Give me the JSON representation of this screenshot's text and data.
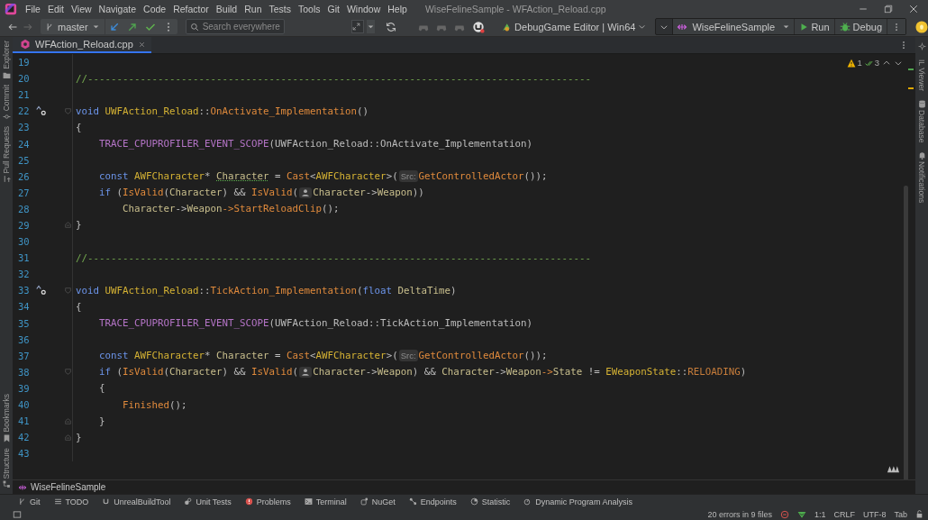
{
  "window": {
    "title": "WiseFelineSample - WFAction_Reload.cpp"
  },
  "menu": [
    "File",
    "Edit",
    "View",
    "Navigate",
    "Code",
    "Refactor",
    "Build",
    "Run",
    "Tests",
    "Tools",
    "Git",
    "Window",
    "Help"
  ],
  "toolbar": {
    "branch": "master",
    "search": {
      "placeholder": "Search everywhere"
    },
    "configuration": "DebugGame Editor | Win64",
    "run_target": "WiseFelineSample",
    "run_button": "Run",
    "debug_button": "Debug"
  },
  "left_strip_top": [
    {
      "label": "Explorer",
      "kind": "folder"
    },
    {
      "label": "Commit",
      "kind": "commit"
    },
    {
      "label": "Pull Requests",
      "kind": "pull"
    }
  ],
  "left_strip_bottom": [
    {
      "label": "Bookmarks",
      "kind": "bookmark"
    },
    {
      "label": "Structure",
      "kind": "structure"
    }
  ],
  "right_strip": [
    {
      "label": "IL Viewer",
      "kind": "plain"
    },
    {
      "label": "Database",
      "kind": "database"
    },
    {
      "label": "Notifications",
      "kind": "bell"
    }
  ],
  "tabs": [
    {
      "label": "WFAction_Reload.cpp",
      "selected": true
    }
  ],
  "inspections": {
    "warnings": "1",
    "weak_warnings": "3"
  },
  "code_lines": [
    {
      "number": "19"
    },
    {
      "number": "20",
      "tokens": [
        {
          "kind": "comment",
          "text": "//--------------------------------------------------------------------------------------"
        }
      ]
    },
    {
      "number": "21"
    },
    {
      "number": "22",
      "override_marker": true,
      "fold_start": true,
      "tokens": [
        {
          "kind": "kw",
          "text": "void"
        },
        {
          "kind": "type",
          "text": " UWFAction_Reload"
        },
        {
          "kind": "plain",
          "text": "::"
        },
        {
          "kind": "fn",
          "text": "OnActivate_Implementation"
        },
        {
          "kind": "plain",
          "text": "()"
        }
      ]
    },
    {
      "number": "23",
      "tokens": [
        {
          "kind": "plain",
          "text": "{"
        }
      ]
    },
    {
      "number": "24",
      "tokens": [
        {
          "kind": "macro",
          "text": "    TRACE_CPUPROFILER_EVENT_SCOPE"
        },
        {
          "kind": "plain",
          "text": "(UWFAction_Reload::OnActivate_Implementation)"
        }
      ]
    },
    {
      "number": "25"
    },
    {
      "number": "26",
      "tokens": [
        {
          "kind": "kw",
          "text": "    const"
        },
        {
          "kind": "type",
          "text": " AWFCharacter"
        },
        {
          "kind": "plain",
          "text": "* "
        },
        {
          "kind": "var",
          "text": "Character",
          "underlined": true
        },
        {
          "kind": "plain",
          "text": " = "
        },
        {
          "kind": "fn",
          "text": "Cast"
        },
        {
          "kind": "plain",
          "text": "<"
        },
        {
          "kind": "type",
          "text": "AWFCharacter"
        },
        {
          "kind": "plain",
          "text": ">("
        },
        {
          "kind": "hint",
          "text": "Src:"
        },
        {
          "kind": "fn",
          "text": "GetControlledActor"
        },
        {
          "kind": "plain",
          "text": "());"
        }
      ]
    },
    {
      "number": "27",
      "tokens": [
        {
          "kind": "kw",
          "text": "    if"
        },
        {
          "kind": "plain",
          "text": " ("
        },
        {
          "kind": "fn",
          "text": "IsValid"
        },
        {
          "kind": "plain",
          "text": "("
        },
        {
          "kind": "var",
          "text": "Character"
        },
        {
          "kind": "plain",
          "text": ") && "
        },
        {
          "kind": "fn",
          "text": "IsValid"
        },
        {
          "kind": "plain",
          "text": "("
        },
        {
          "kind": "hint-icon"
        },
        {
          "kind": "var",
          "text": "Character"
        },
        {
          "kind": "plain",
          "text": "->"
        },
        {
          "kind": "var",
          "text": "Weapon"
        },
        {
          "kind": "plain",
          "text": "))"
        }
      ]
    },
    {
      "number": "28",
      "tokens": [
        {
          "kind": "var",
          "text": "        Character"
        },
        {
          "kind": "plain",
          "text": "->"
        },
        {
          "kind": "var",
          "text": "Weapon"
        },
        {
          "kind": "op",
          "text": "->"
        },
        {
          "kind": "fn",
          "text": "StartReloadClip"
        },
        {
          "kind": "plain",
          "text": "();"
        }
      ]
    },
    {
      "number": "29",
      "fold_end": true,
      "tokens": [
        {
          "kind": "plain",
          "text": "}"
        }
      ]
    },
    {
      "number": "30"
    },
    {
      "number": "31",
      "tokens": [
        {
          "kind": "comment",
          "text": "//--------------------------------------------------------------------------------------"
        }
      ]
    },
    {
      "number": "32"
    },
    {
      "number": "33",
      "override_marker": true,
      "fold_start": true,
      "tokens": [
        {
          "kind": "kw",
          "text": "void"
        },
        {
          "kind": "type",
          "text": " UWFAction_Reload"
        },
        {
          "kind": "plain",
          "text": "::"
        },
        {
          "kind": "fn",
          "text": "TickAction_Implementation"
        },
        {
          "kind": "plain",
          "text": "("
        },
        {
          "kind": "kw",
          "text": "float"
        },
        {
          "kind": "var",
          "text": " DeltaTime"
        },
        {
          "kind": "plain",
          "text": ")"
        }
      ]
    },
    {
      "number": "34",
      "tokens": [
        {
          "kind": "plain",
          "text": "{"
        }
      ]
    },
    {
      "number": "35",
      "tokens": [
        {
          "kind": "macro",
          "text": "    TRACE_CPUPROFILER_EVENT_SCOPE"
        },
        {
          "kind": "plain",
          "text": "(UWFAction_Reload::TickAction_Implementation)"
        }
      ]
    },
    {
      "number": "36"
    },
    {
      "number": "37",
      "tokens": [
        {
          "kind": "kw",
          "text": "    const"
        },
        {
          "kind": "type",
          "text": " AWFCharacter"
        },
        {
          "kind": "plain",
          "text": "* "
        },
        {
          "kind": "var",
          "text": "Character"
        },
        {
          "kind": "plain",
          "text": " = "
        },
        {
          "kind": "fn",
          "text": "Cast"
        },
        {
          "kind": "plain",
          "text": "<"
        },
        {
          "kind": "type",
          "text": "AWFCharacter"
        },
        {
          "kind": "plain",
          "text": ">("
        },
        {
          "kind": "hint",
          "text": "Src:"
        },
        {
          "kind": "fn",
          "text": "GetControlledActor"
        },
        {
          "kind": "plain",
          "text": "());"
        }
      ]
    },
    {
      "number": "38",
      "fold_start": true,
      "tokens": [
        {
          "kind": "kw",
          "text": "    if"
        },
        {
          "kind": "plain",
          "text": " ("
        },
        {
          "kind": "fn",
          "text": "IsValid"
        },
        {
          "kind": "plain",
          "text": "("
        },
        {
          "kind": "var",
          "text": "Character"
        },
        {
          "kind": "plain",
          "text": ") && "
        },
        {
          "kind": "fn",
          "text": "IsValid"
        },
        {
          "kind": "plain",
          "text": "("
        },
        {
          "kind": "hint-icon"
        },
        {
          "kind": "var",
          "text": "Character"
        },
        {
          "kind": "plain",
          "text": "->"
        },
        {
          "kind": "var",
          "text": "Weapon"
        },
        {
          "kind": "plain",
          "text": ") && "
        },
        {
          "kind": "var",
          "text": "Character"
        },
        {
          "kind": "plain",
          "text": "->"
        },
        {
          "kind": "var",
          "text": "Weapon"
        },
        {
          "kind": "op",
          "text": "->"
        },
        {
          "kind": "var",
          "text": "State"
        },
        {
          "kind": "plain",
          "text": " != "
        },
        {
          "kind": "type",
          "text": "EWeaponState"
        },
        {
          "kind": "plain",
          "text": "::"
        },
        {
          "kind": "enum",
          "text": "RELOADING"
        },
        {
          "kind": "plain",
          "text": ")"
        }
      ]
    },
    {
      "number": "39",
      "tokens": [
        {
          "kind": "plain",
          "text": "    {"
        }
      ]
    },
    {
      "number": "40",
      "tokens": [
        {
          "kind": "fn",
          "text": "        Finished"
        },
        {
          "kind": "plain",
          "text": "();"
        }
      ]
    },
    {
      "number": "41",
      "fold_end": true,
      "tokens": [
        {
          "kind": "plain",
          "text": "    }"
        }
      ]
    },
    {
      "number": "42",
      "fold_end": true,
      "tokens": [
        {
          "kind": "plain",
          "text": "}"
        }
      ]
    },
    {
      "number": "43"
    }
  ],
  "breadcrumb": "WiseFelineSample",
  "tool_windows": [
    {
      "label": "Git",
      "kind": "git"
    },
    {
      "label": "TODO",
      "kind": "todo"
    },
    {
      "label": "UnrealBuildTool",
      "kind": "ubt"
    },
    {
      "label": "Unit Tests",
      "kind": "tests"
    },
    {
      "label": "Problems",
      "kind": "problems"
    },
    {
      "label": "Terminal",
      "kind": "terminal"
    },
    {
      "label": "NuGet",
      "kind": "nuget"
    },
    {
      "label": "Endpoints",
      "kind": "endpoints"
    },
    {
      "label": "Statistic",
      "kind": "statistic"
    },
    {
      "label": "Dynamic Program Analysis",
      "kind": "dpa"
    }
  ],
  "status_bar": {
    "problems": "20 errors in 9 files",
    "position": "1:1",
    "line_ending": "CRLF",
    "encoding": "UTF-8",
    "indent": "Tab"
  }
}
